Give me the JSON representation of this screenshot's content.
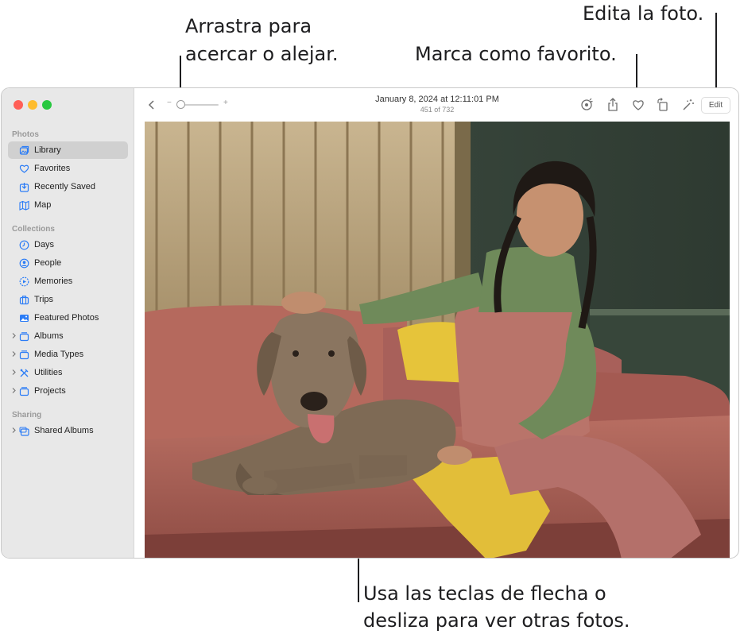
{
  "callouts": {
    "zoom": [
      "Arrastra para",
      "acercar o alejar."
    ],
    "favorite": "Marca como favorito.",
    "edit": "Edita la foto.",
    "navigate": [
      "Usa las teclas de flecha o",
      "desliza para ver otras fotos."
    ]
  },
  "window": {
    "traffic_lights": {
      "close": "#ff5f57",
      "minimize": "#febc2e",
      "zoom": "#28c840"
    },
    "accent_color": "#2b7cf6"
  },
  "sidebar": {
    "sections": [
      {
        "title": "Photos",
        "items": [
          {
            "label": "Library",
            "icon": "library-icon",
            "selected": true
          },
          {
            "label": "Favorites",
            "icon": "heart-icon"
          },
          {
            "label": "Recently Saved",
            "icon": "download-icon"
          },
          {
            "label": "Map",
            "icon": "map-icon"
          }
        ]
      },
      {
        "title": "Collections",
        "items": [
          {
            "label": "Days",
            "icon": "clock-icon"
          },
          {
            "label": "People",
            "icon": "person-icon"
          },
          {
            "label": "Memories",
            "icon": "memories-icon"
          },
          {
            "label": "Trips",
            "icon": "suitcase-icon"
          },
          {
            "label": "Featured Photos",
            "icon": "photo-icon"
          },
          {
            "label": "Albums",
            "icon": "folder-icon",
            "expandable": true
          },
          {
            "label": "Media Types",
            "icon": "folder-icon",
            "expandable": true
          },
          {
            "label": "Utilities",
            "icon": "tools-icon",
            "expandable": true
          },
          {
            "label": "Projects",
            "icon": "folder-icon",
            "expandable": true
          }
        ]
      },
      {
        "title": "Sharing",
        "items": [
          {
            "label": "Shared Albums",
            "icon": "shared-albums-icon",
            "expandable": true
          }
        ]
      }
    ]
  },
  "toolbar": {
    "date": "January 8, 2024 at 12:11:01 PM",
    "count": "451 of 732",
    "zoom_minus": "−",
    "zoom_plus": "+",
    "edit_label": "Edit",
    "icons": [
      "back-icon",
      "visual-lookup-icon",
      "share-icon",
      "favorite-heart-icon",
      "rotate-icon",
      "enhance-wand-icon"
    ]
  },
  "photo": {
    "subject": "girl-and-dog-on-sofa"
  }
}
